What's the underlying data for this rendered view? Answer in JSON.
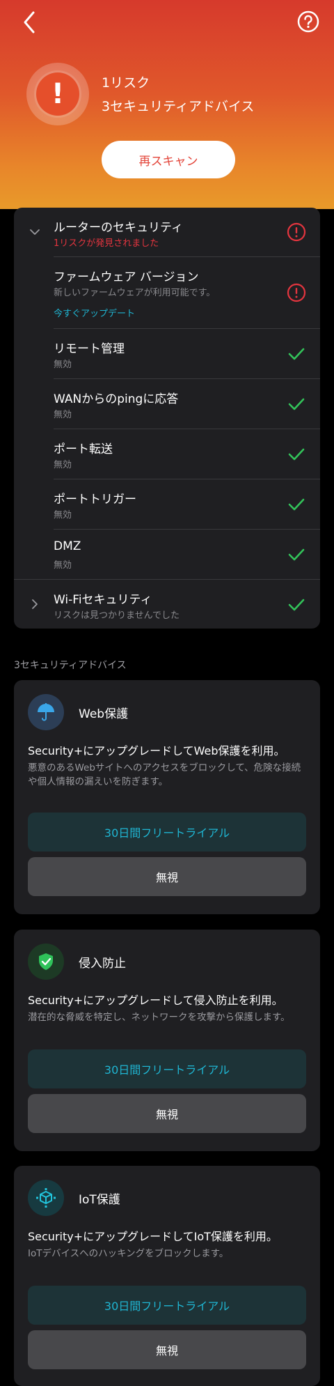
{
  "hero": {
    "risk_count": "1リスク",
    "advice_count": "3セキュリティアドバイス",
    "rescan_label": "再スキャン"
  },
  "router": {
    "title": "ルーターのセキュリティ",
    "subtitle": "1リスクが発見されました",
    "items": [
      {
        "title": "ファームウェア バージョン",
        "sub": "新しいファームウェアが利用可能です。",
        "link": "今すぐアップデート",
        "status": "risk"
      },
      {
        "title": "リモート管理",
        "sub": "無効",
        "status": "ok"
      },
      {
        "title": "WANからのpingに応答",
        "sub": "無効",
        "status": "ok"
      },
      {
        "title": "ポート転送",
        "sub": "無効",
        "status": "ok"
      },
      {
        "title": "ポートトリガー",
        "sub": "無効",
        "status": "ok"
      },
      {
        "title": "DMZ",
        "sub": "無効",
        "status": "ok"
      }
    ]
  },
  "wifi": {
    "title": "Wi-Fiセキュリティ",
    "subtitle": "リスクは見つかりませんでした"
  },
  "advice_section_label": "3セキュリティアドバイス",
  "advices": [
    {
      "icon": "umbrella-icon",
      "title": "Web保護",
      "headline": "Security+にアップグレードしてWeb保護を利用。",
      "desc": "悪意のあるWebサイトへのアクセスをブロックして、危険な接続や個人情報の漏えいを防ぎます。",
      "trial_label": "30日間フリートライアル",
      "ignore_label": "無視"
    },
    {
      "icon": "shield-check-icon",
      "title": "侵入防止",
      "headline": "Security+にアップグレードして侵入防止を利用。",
      "desc": "潜在的な脅威を特定し、ネットワークを攻撃から保護します。",
      "trial_label": "30日間フリートライアル",
      "ignore_label": "無視"
    },
    {
      "icon": "iot-cube-icon",
      "title": "IoT保護",
      "headline": "Security+にアップグレードしてIoT保護を利用。",
      "desc": "IoTデバイスへのハッキングをブロックします。",
      "trial_label": "30日間フリートライアル",
      "ignore_label": "無視"
    }
  ],
  "colors": {
    "risk": "#e5353f",
    "ok": "#33c35a",
    "link": "#1fb6d3",
    "card": "#1f1f22"
  }
}
